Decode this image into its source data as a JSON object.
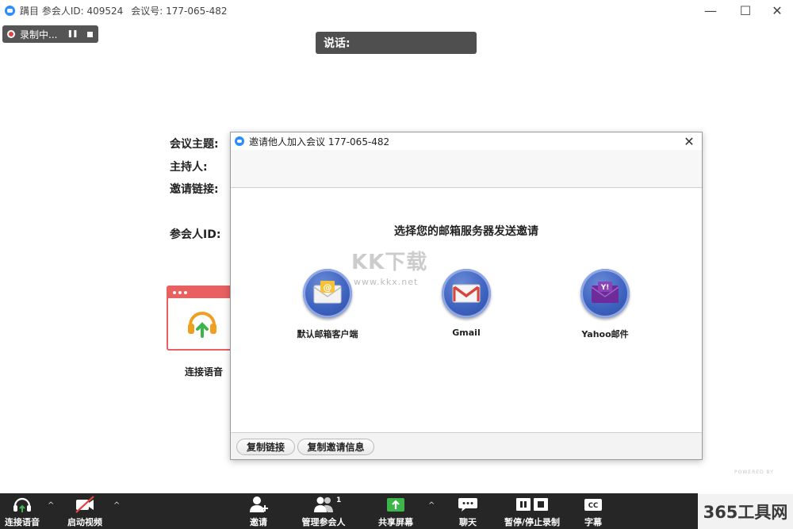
{
  "window": {
    "title": "蹒目 参会人ID: 409524",
    "meeting_no": "会议号: 177-065-482",
    "min_symbol": "—",
    "max_symbol": "☐",
    "close_symbol": "✕"
  },
  "recording": {
    "label": "录制中...",
    "pause_symbol": "❚❚"
  },
  "speaking": {
    "label": "说话:"
  },
  "meeting_info": {
    "topic_label": "会议主题:",
    "host_label": "主持人:",
    "invite_link_label": "邀请链接:",
    "participant_id_label": "参会人ID:"
  },
  "audio_card": {
    "label": "连接语音"
  },
  "invite_dialog": {
    "title": "邀请他人加入会议 177-065-482",
    "close_symbol": "✕",
    "heading": "选择您的邮箱服务器发送邀请",
    "options": [
      {
        "label": "默认邮箱客户端",
        "icon": "default-mail-icon"
      },
      {
        "label": "Gmail",
        "icon": "gmail-icon"
      },
      {
        "label": "Yahoo邮件",
        "icon": "yahoo-mail-icon"
      }
    ],
    "copy_link": "复制链接",
    "copy_invite": "复制邀请信息"
  },
  "watermark": {
    "text": "KK下载",
    "url": "www.kkx.net"
  },
  "powered_by": "POWERED BY",
  "site_badge": "365工具网",
  "toolbar": {
    "items": [
      {
        "label": "连接语音",
        "icon": "headset-icon"
      },
      {
        "label": "启动视频",
        "icon": "video-off-icon"
      },
      {
        "label": "邀请",
        "icon": "invite-icon"
      },
      {
        "label": "管理参会人",
        "icon": "participants-icon",
        "count": "1"
      },
      {
        "label": "共享屏幕",
        "icon": "share-screen-icon"
      },
      {
        "label": "聊天",
        "icon": "chat-icon"
      },
      {
        "label": "暂停/停止录制",
        "icon": "pause-stop-record-icon"
      },
      {
        "label": "字幕",
        "icon": "cc-icon",
        "icon_text": "CC"
      }
    ],
    "caret": "^"
  },
  "colors": {
    "toolbar_bg": "#262626",
    "share_green": "#3cb64a",
    "accent_blue": "#2d8cff",
    "audio_red": "#e96060",
    "mail_circle_blue": "#3e63bf"
  }
}
